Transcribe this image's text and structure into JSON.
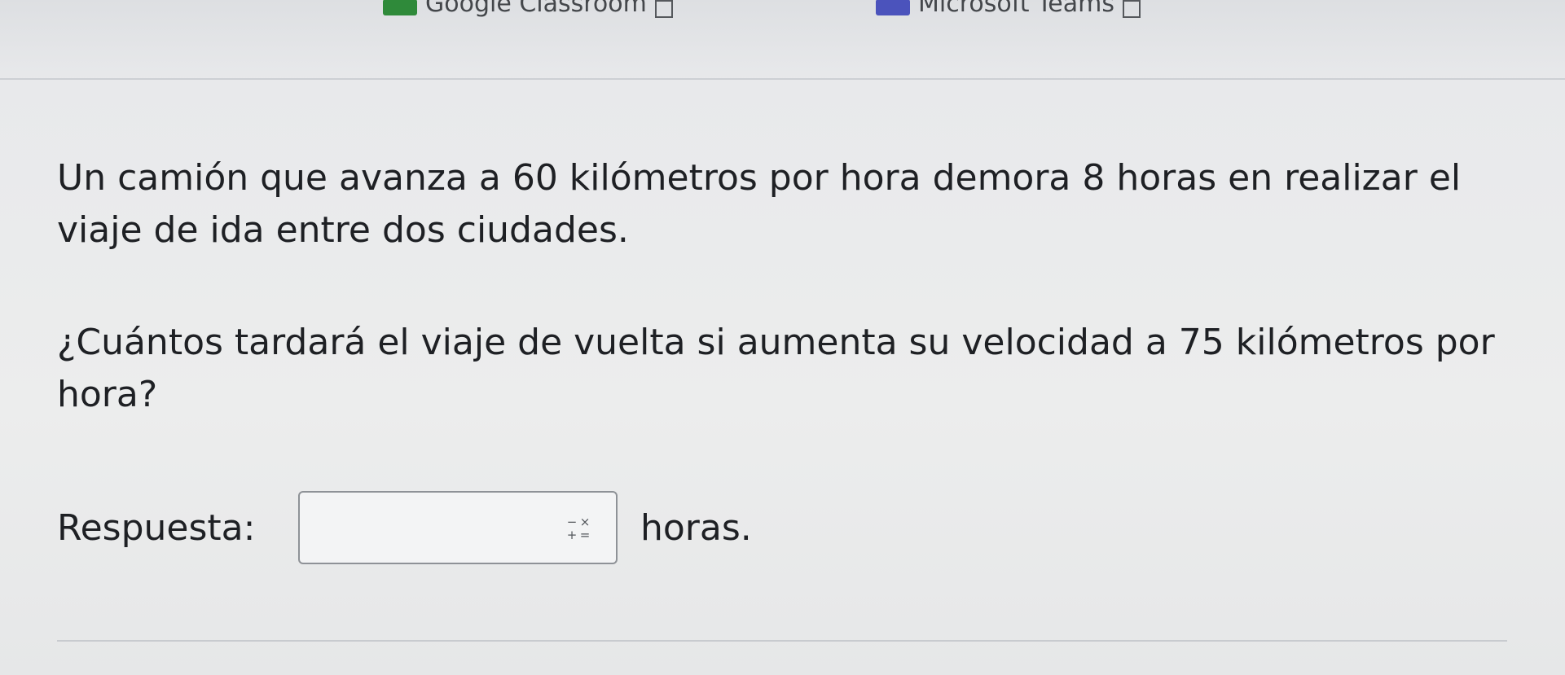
{
  "browser_bar": {
    "links": [
      {
        "label": "Google Classroom",
        "icon": "external-link-icon"
      },
      {
        "label": "Microsoft Teams",
        "icon": "external-link-icon"
      }
    ]
  },
  "problem": {
    "statement": "Un camión que avanza a 60 kilómetros por hora demora 8 horas en realizar el viaje de ida entre dos ciudades.",
    "question": "¿Cuántos tardará el viaje de vuelta si aumenta su velocidad a 75 kilómetros por hora?"
  },
  "answer": {
    "label": "Respuesta:",
    "value": "",
    "math_symbols": [
      "−",
      "×",
      "+",
      "="
    ],
    "unit": "horas."
  }
}
